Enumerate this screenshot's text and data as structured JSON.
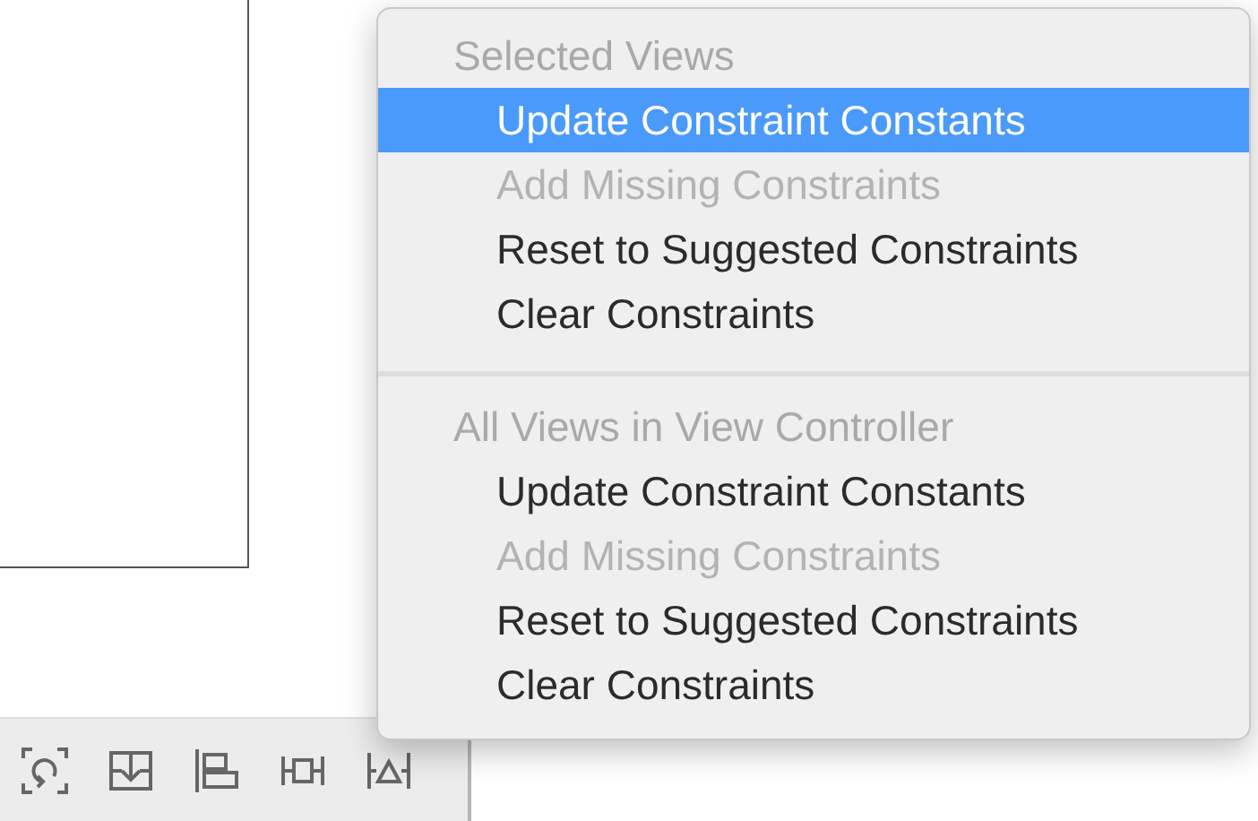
{
  "menu": {
    "sections": [
      {
        "header": "Selected Views",
        "items": [
          {
            "label": "Update Constraint Constants",
            "disabled": false,
            "selected": true
          },
          {
            "label": "Add Missing Constraints",
            "disabled": true,
            "selected": false
          },
          {
            "label": "Reset to Suggested Constraints",
            "disabled": false,
            "selected": false
          },
          {
            "label": "Clear Constraints",
            "disabled": false,
            "selected": false
          }
        ]
      },
      {
        "header": "All Views in View Controller",
        "items": [
          {
            "label": "Update Constraint Constants",
            "disabled": false,
            "selected": false
          },
          {
            "label": "Add Missing Constraints",
            "disabled": true,
            "selected": false
          },
          {
            "label": "Reset to Suggested Constraints",
            "disabled": false,
            "selected": false
          },
          {
            "label": "Clear Constraints",
            "disabled": false,
            "selected": false
          }
        ]
      }
    ]
  }
}
